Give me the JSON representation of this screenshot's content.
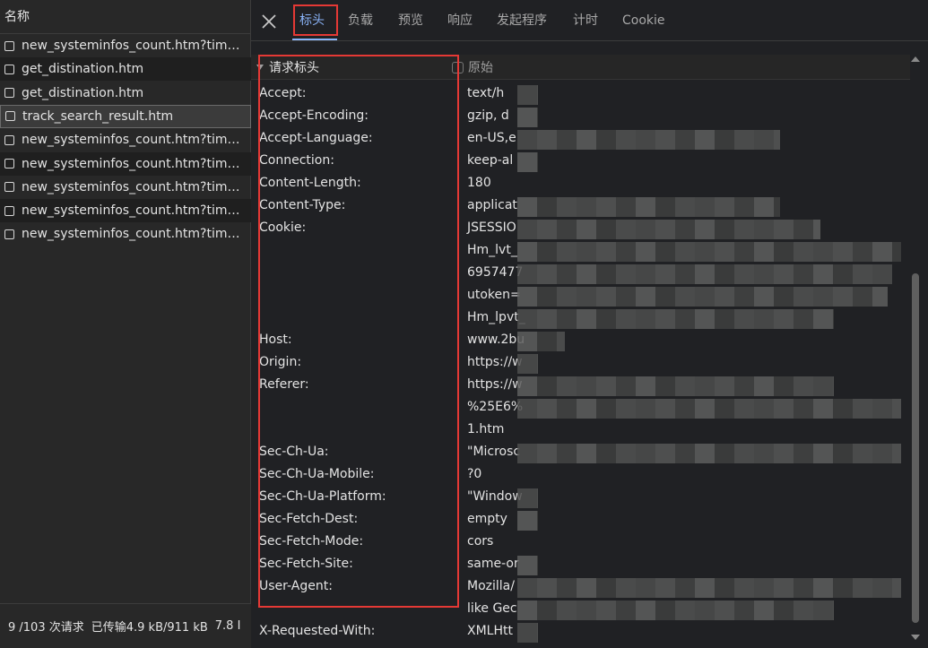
{
  "request_list": {
    "header": "名称",
    "items": [
      {
        "name": "new_systeminfos_count.htm?timest..."
      },
      {
        "name": "get_distination.htm"
      },
      {
        "name": "get_distination.htm"
      },
      {
        "name": "track_search_result.htm"
      },
      {
        "name": "new_systeminfos_count.htm?timest..."
      },
      {
        "name": "new_systeminfos_count.htm?timest..."
      },
      {
        "name": "new_systeminfos_count.htm?timest..."
      },
      {
        "name": "new_systeminfos_count.htm?timest..."
      },
      {
        "name": "new_systeminfos_count.htm?timest..."
      }
    ],
    "status": {
      "requests": "9 /103 次请求",
      "transferred": "已传输4.9 kB/911 kB",
      "extra": "7.8 I"
    }
  },
  "tabs": [
    "标头",
    "负载",
    "预览",
    "响应",
    "发起程序",
    "计时",
    "Cookie"
  ],
  "active_tab": "标头",
  "section": {
    "title": "请求标头",
    "raw_label": "原始"
  },
  "headers": [
    {
      "name": "Accept:",
      "value": "text/h"
    },
    {
      "name": "Accept-Encoding:",
      "value": "gzip, d"
    },
    {
      "name": "Accept-Language:",
      "value": "en-US,e"
    },
    {
      "name": "Connection:",
      "value": "keep-al"
    },
    {
      "name": "Content-Length:",
      "value": "180"
    },
    {
      "name": "Content-Type:",
      "value": "applicat"
    },
    {
      "name": "Cookie:",
      "value": "JSESSIO"
    },
    {
      "name": "",
      "value": "Hm_lvt_"
    },
    {
      "name": "",
      "value": "6957477"
    },
    {
      "name": "",
      "value": "utoken="
    },
    {
      "name": "",
      "value": "Hm_lpvt_"
    },
    {
      "name": "Host:",
      "value": "www.2bu"
    },
    {
      "name": "Origin:",
      "value": "https://w"
    },
    {
      "name": "Referer:",
      "value": "https://w"
    },
    {
      "name": "",
      "value": "%25E6%"
    },
    {
      "name": "",
      "value": "1.htm"
    },
    {
      "name": "Sec-Ch-Ua:",
      "value": "\"Microsc"
    },
    {
      "name": "Sec-Ch-Ua-Mobile:",
      "value": "?0"
    },
    {
      "name": "Sec-Ch-Ua-Platform:",
      "value": "\"Window"
    },
    {
      "name": "Sec-Fetch-Dest:",
      "value": "empty"
    },
    {
      "name": "Sec-Fetch-Mode:",
      "value": "cors"
    },
    {
      "name": "Sec-Fetch-Site:",
      "value": "same-or"
    },
    {
      "name": "User-Agent:",
      "value": "Mozilla/"
    },
    {
      "name": "",
      "value": "like Gec"
    },
    {
      "name": "X-Requested-With:",
      "value": "XMLHtt"
    }
  ],
  "colors": {
    "accent": "#8ab4f8",
    "highlight": "#e53935"
  }
}
